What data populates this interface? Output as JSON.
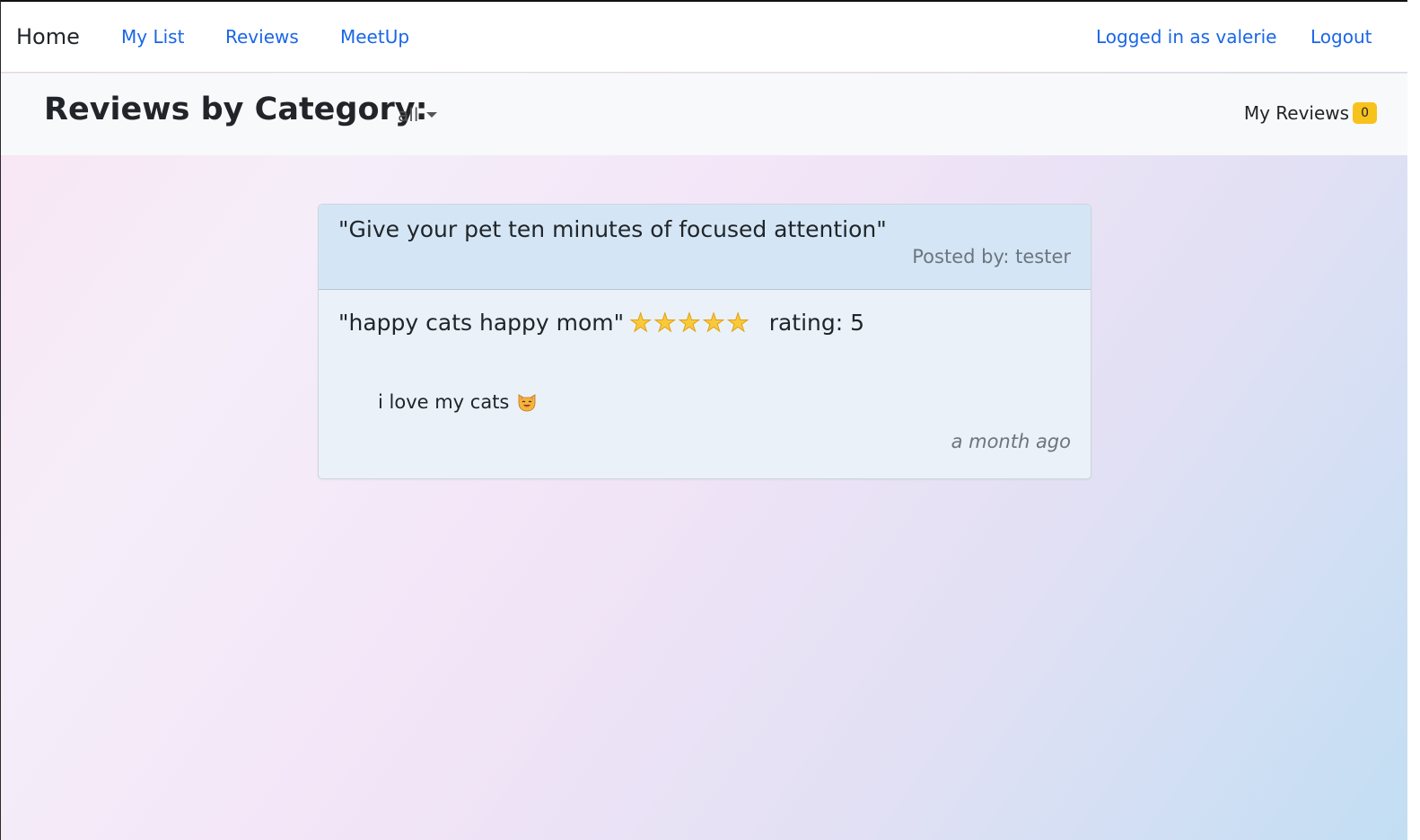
{
  "navbar": {
    "brand": "Home",
    "links": [
      "My List",
      "Reviews",
      "MeetUp"
    ],
    "user_status": "Logged in as valerie",
    "logout": "Logout"
  },
  "subheader": {
    "title": "Reviews by Category:",
    "category_selected": "all",
    "my_reviews_label": "My Reviews",
    "my_reviews_count": "0"
  },
  "reviews": [
    {
      "title": "\"Give your pet ten minutes of focused attention\"",
      "posted_by": "Posted by: tester",
      "headline": "\"happy cats happy mom\"",
      "stars": 5,
      "rating_text": "rating: 5",
      "body": "i love my cats",
      "time": "a month ago"
    }
  ],
  "colors": {
    "link": "#1a66e8",
    "badge": "#f7c21b",
    "card_header": "#d4e6f5",
    "star": "#f9c93c"
  },
  "icons": {
    "star": "star-icon",
    "emoji": "smiling-cat-icon",
    "dropdown": "caret-down-icon"
  }
}
